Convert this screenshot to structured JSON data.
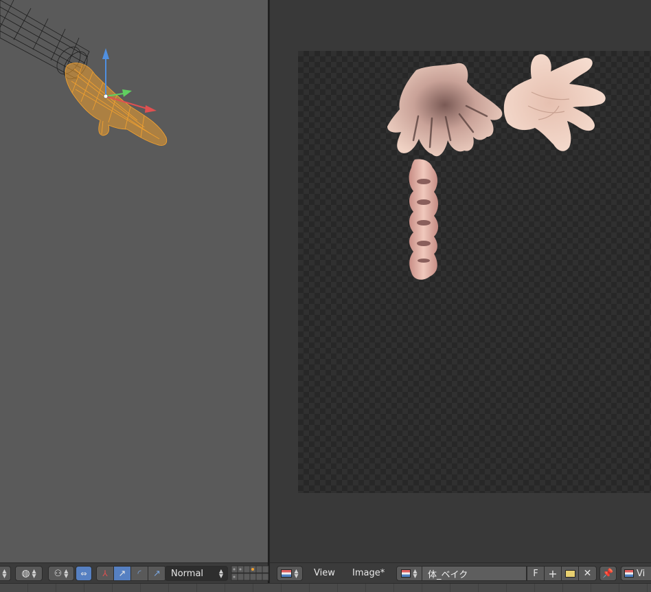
{
  "viewport3d": {
    "shading_mode": "Normal",
    "icons": [
      "viewport-shading-icon",
      "pivot-icon",
      "manipulator-icon",
      "translate-icon",
      "rotate-icon",
      "scale-icon",
      "layers-icon"
    ]
  },
  "image_editor": {
    "menu_view": "View",
    "menu_image": "Image*",
    "image_name": "体_ベイク",
    "fake_user": "F",
    "overflow_label": "Vi"
  },
  "colors": {
    "selection_orange": "#f0a030",
    "axis_x": "#e05050",
    "axis_y": "#60d060",
    "axis_z": "#5090e0",
    "active_button": "#5680c2",
    "skin": "#ecc8b8"
  }
}
